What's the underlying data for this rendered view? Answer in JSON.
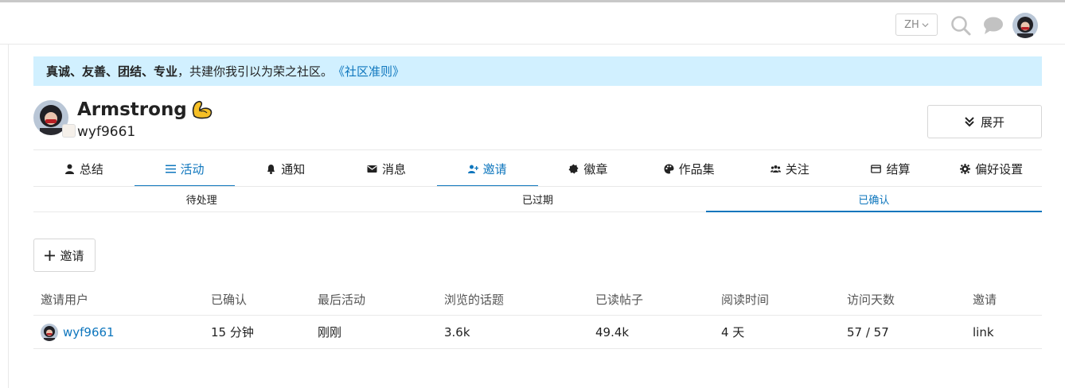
{
  "header": {
    "lang_label": "ZH",
    "icons": [
      "chevron-down-icon",
      "search-icon",
      "chat-icon",
      "avatar"
    ]
  },
  "banner": {
    "bold_text": "真诚、友善、团结、专业",
    "text": "，共建你我引以为荣之社区。",
    "link_text": "《社区准则》"
  },
  "profile": {
    "name": "Armstrong",
    "emoji_icon": "flexed-biceps-icon",
    "username": "wyf9661",
    "expand_label": "展开"
  },
  "nav": {
    "items": [
      {
        "label": "总结",
        "icon": "user-icon"
      },
      {
        "label": "活动",
        "icon": "list-icon"
      },
      {
        "label": "通知",
        "icon": "bell-icon"
      },
      {
        "label": "消息",
        "icon": "envelope-icon"
      },
      {
        "label": "邀请",
        "icon": "user-plus-icon"
      },
      {
        "label": "徽章",
        "icon": "badge-icon"
      },
      {
        "label": "作品集",
        "icon": "palette-icon"
      },
      {
        "label": "关注",
        "icon": "users-icon"
      },
      {
        "label": "结算",
        "icon": "credit-card-icon"
      },
      {
        "label": "偏好设置",
        "icon": "gear-icon"
      }
    ]
  },
  "subnav": {
    "items": [
      "待处理",
      "已过期",
      "已确认"
    ]
  },
  "invite_button": {
    "label": "邀请"
  },
  "table": {
    "headers": [
      "邀请用户",
      "已确认",
      "最后活动",
      "浏览的话题",
      "已读帖子",
      "阅读时间",
      "访问天数",
      "邀请"
    ],
    "rows": [
      [
        "wyf9661",
        "15 分钟",
        "刚刚",
        "3.6k",
        "49.4k",
        "4 天",
        "57 / 57",
        "link"
      ]
    ]
  },
  "colors": {
    "accent": "#0e76bd",
    "banner_bg": "#d1f0ff",
    "border": "#e9e9e9"
  }
}
